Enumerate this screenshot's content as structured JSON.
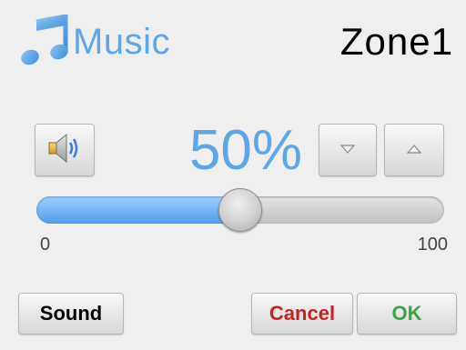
{
  "header": {
    "title": "Music",
    "zone": "Zone1"
  },
  "icons": {
    "music": "music-note-icon",
    "speaker": "speaker-icon",
    "down": "triangle-down-icon",
    "up": "triangle-up-icon"
  },
  "volume": {
    "display": "50%",
    "level": 0.5,
    "min_label": "0",
    "max_label": "100"
  },
  "buttons": {
    "sound": "Sound",
    "cancel": "Cancel",
    "ok": "OK"
  },
  "colors": {
    "accent": "#5fa6e6",
    "cancel": "#cc1f1f",
    "ok": "#3aa640",
    "background": "#efefef"
  }
}
